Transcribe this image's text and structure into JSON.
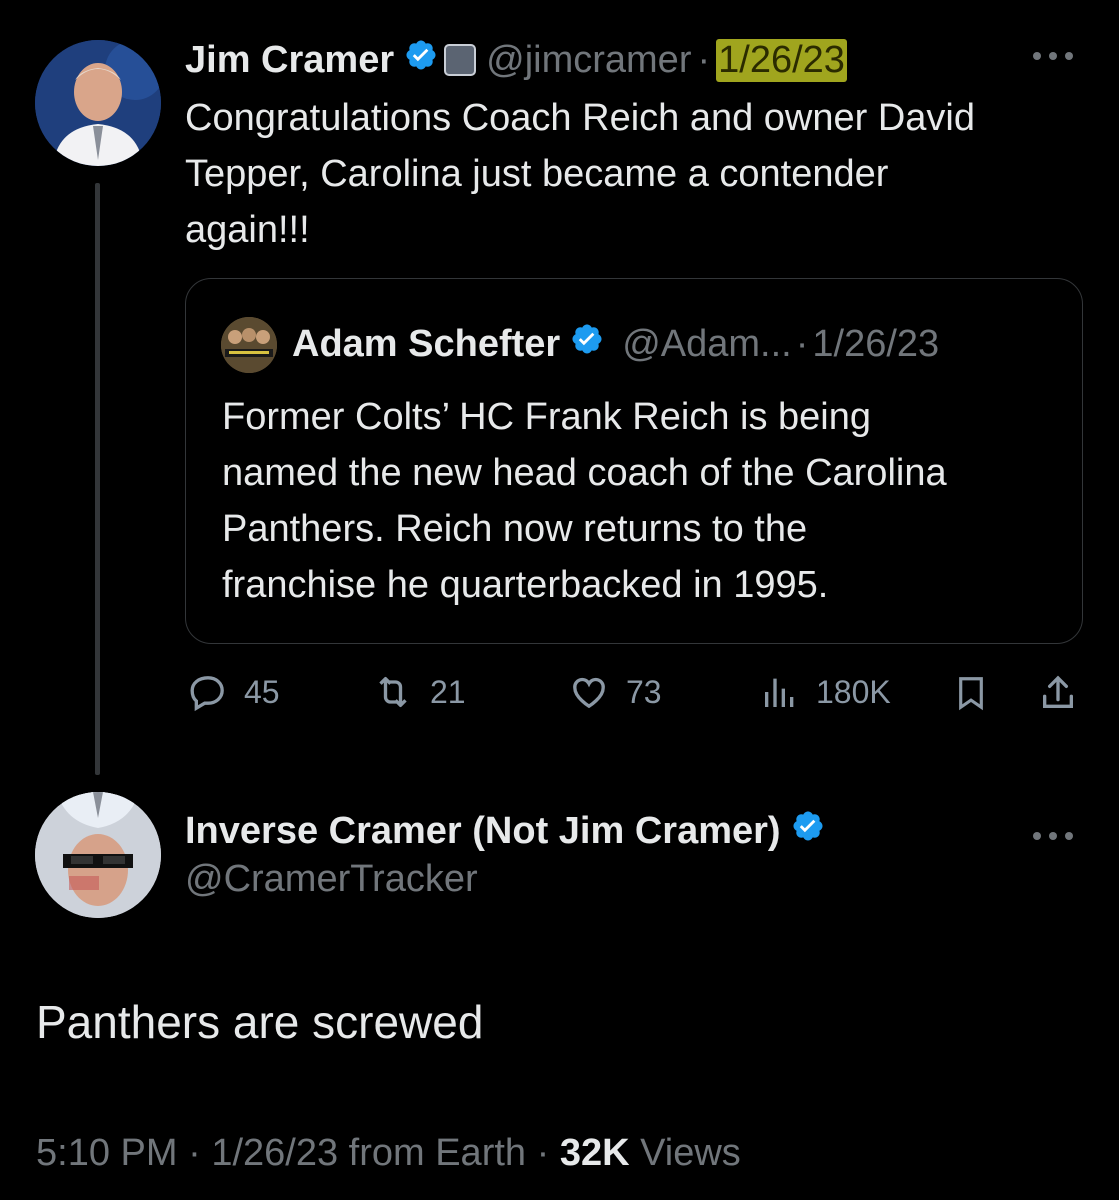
{
  "tweet": {
    "author": {
      "name": "Jim Cramer",
      "handle": "@jimcramer",
      "separator": "·",
      "date": "1/26/23"
    },
    "text_lines": [
      "Congratulations Coach Reich and owner David",
      "Tepper, Carolina just became a contender",
      "again!!!"
    ],
    "quote": {
      "author": {
        "name": "Adam Schefter",
        "handle": "@Adam...",
        "separator": "·",
        "date": "1/26/23"
      },
      "text_lines": [
        "Former Colts’ HC Frank Reich is being",
        "named the new head coach of the Carolina",
        "Panthers. Reich now returns to the",
        "franchise he quarterbacked in 1995."
      ]
    },
    "stats": {
      "replies": "45",
      "retweets": "21",
      "likes": "73",
      "views": "180K"
    },
    "highlight_color": "#d6dc28"
  },
  "reply": {
    "author": {
      "name": "Inverse Cramer (Not Jim Cramer)",
      "handle": "@CramerTracker"
    },
    "text": "Panthers are screwed",
    "meta": {
      "time": "5:10 PM",
      "separator": "·",
      "date_source": "1/26/23 from Earth",
      "separator2": "·",
      "views_count": "32K",
      "views_label": "Views"
    }
  },
  "colors": {
    "background": "#000000",
    "text": "#e7e9ea",
    "muted": "#71767b",
    "verified": "#1d9bf0",
    "border": "#333639"
  },
  "icons": [
    "verified-badge-icon",
    "more-icon",
    "reply-icon",
    "retweet-icon",
    "like-icon",
    "views-icon",
    "bookmark-icon",
    "share-icon"
  ]
}
